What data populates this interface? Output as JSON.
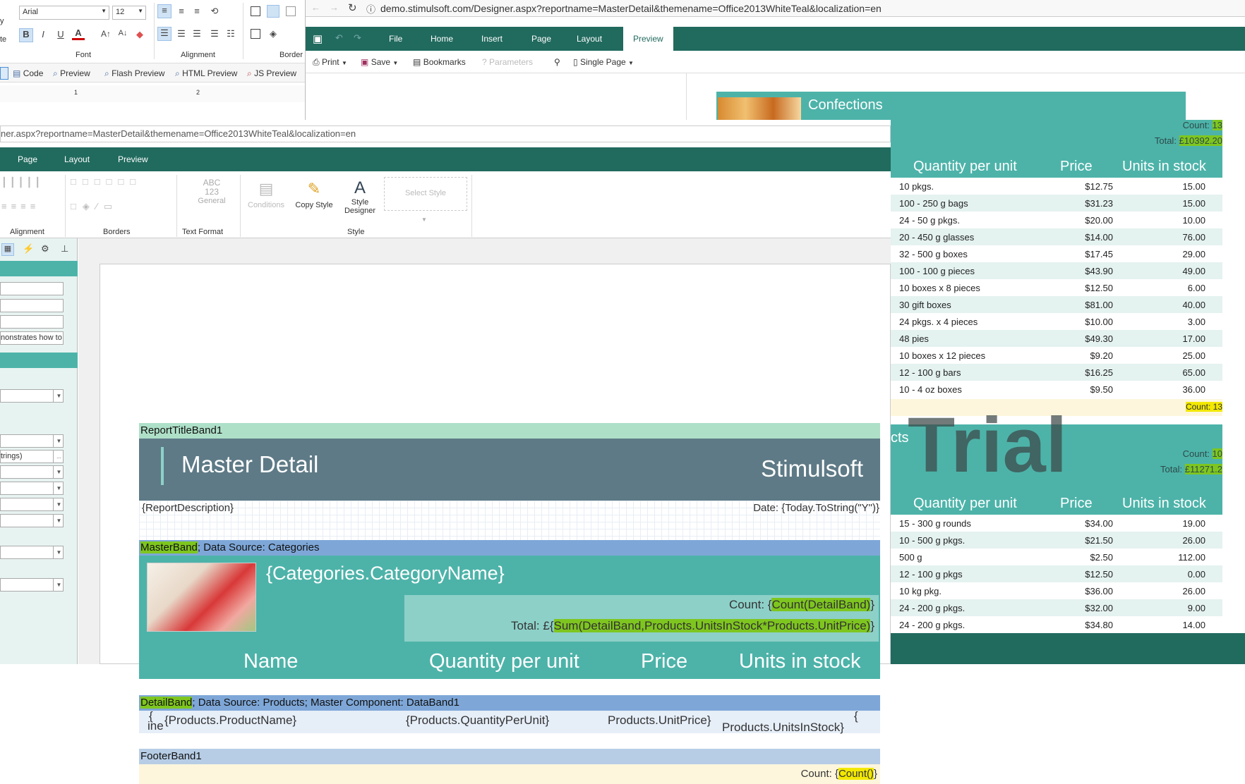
{
  "win_a": {
    "font_name": "Arial",
    "font_size": "12",
    "ribbon_groups": [
      "Font",
      "Alignment",
      "Border"
    ],
    "cut_text": "y",
    "cut_text2": "te",
    "preview_tabs": [
      "Code",
      "Preview",
      "Flash Preview",
      "HTML Preview",
      "JS Preview"
    ],
    "ruler_marks": [
      "1",
      "2"
    ]
  },
  "win_b": {
    "address": "ner.aspx?reportname=MasterDetail&themename=Office2013WhiteTeal&localization=en",
    "tabs": [
      "Page",
      "Layout",
      "Preview"
    ],
    "text_format": {
      "abc": "ABC",
      "num": "123",
      "general": "General"
    },
    "style_buttons": {
      "conditions": "Conditions",
      "copy_style": "Copy Style",
      "style_designer_1": "Style",
      "style_designer_2": "Designer",
      "select_style": "Select Style"
    },
    "group_labels": {
      "alignment": "Alignment",
      "borders": "Borders",
      "text_format": "Text Format",
      "style": "Style"
    },
    "panel": {
      "field_demo": "nonstrates how to",
      "field_strings": "trings)",
      "ellipsis": "..."
    },
    "report": {
      "title_band": "ReportTitleBand1",
      "title": "Master Detail",
      "brand": "Stimulsoft",
      "description": "{ReportDescription}",
      "date": "Date: {Today.ToString(\"Y\")}",
      "master_band_name": "MasterBand",
      "master_band_rest": "; Data Source: Categories",
      "category_name": "{Categories.CategoryName}",
      "count_prefix": "Count: {",
      "count_expr": "Count(DetailBand)",
      "count_suffix": "}",
      "total_prefix": "Total: £{",
      "total_expr": "Sum(DetailBand,Products.UnitsInStock*Products.UnitPrice)",
      "total_suffix": "}",
      "headers": [
        "Name",
        "Quantity per unit",
        "Price",
        "Units in stock"
      ],
      "detail_band_name": "DetailBand",
      "detail_band_rest": "; Data Source: Products; Master Component: DataBand1",
      "line_frag_1": "{",
      "line_frag_2": "ine",
      "cells": [
        "{Products.ProductName}",
        "{Products.QuantityPerUnit}",
        "Products.UnitPrice}",
        "{",
        "Products.UnitsInStock}"
      ],
      "footer_band": "FooterBand1",
      "footer_prefix": "Count: {",
      "footer_expr": "Count()",
      "footer_suffix": "}"
    }
  },
  "win_c": {
    "address": "demo.stimulsoft.com/Designer.aspx?reportname=MasterDetail&themename=Office2013WhiteTeal&localization=en",
    "tabs": [
      "File",
      "Home",
      "Insert",
      "Page",
      "Layout",
      "Preview"
    ],
    "toolbar": {
      "print": "Print",
      "save": "Save",
      "bookmarks": "Bookmarks",
      "parameters": "Parameters",
      "single_page": "Single Page"
    },
    "confections": "Confections"
  },
  "preview": {
    "s1": {
      "count_label": "Count: ",
      "count": "13",
      "total_label": "Total: ",
      "total": "£10392.20",
      "headers": [
        "Quantity per unit",
        "Price",
        "Units in stock"
      ],
      "rows": [
        [
          "10 pkgs.",
          "$12.75",
          "15.00"
        ],
        [
          "100 - 250 g bags",
          "$31.23",
          "15.00"
        ],
        [
          "24 - 50 g pkgs.",
          "$20.00",
          "10.00"
        ],
        [
          "20 - 450 g glasses",
          "$14.00",
          "76.00"
        ],
        [
          "32 - 500 g boxes",
          "$17.45",
          "29.00"
        ],
        [
          "100 - 100 g pieces",
          "$43.90",
          "49.00"
        ],
        [
          "10 boxes x 8 pieces",
          "$12.50",
          "6.00"
        ],
        [
          "30 gift boxes",
          "$81.00",
          "40.00"
        ],
        [
          "24 pkgs. x 4 pieces",
          "$10.00",
          "3.00"
        ],
        [
          "48 pies",
          "$49.30",
          "17.00"
        ],
        [
          "10 boxes x 12 pieces",
          "$9.20",
          "25.00"
        ],
        [
          "12 - 100 g bars",
          "$16.25",
          "65.00"
        ],
        [
          "10 - 4 oz boxes",
          "$9.50",
          "36.00"
        ]
      ],
      "footer": "Count: 13"
    },
    "watermark": "Trial",
    "cts": "cts",
    "s2": {
      "count_label": "Count: ",
      "count": "10",
      "total_label": "Total: ",
      "total": "£11271.2",
      "headers": [
        "Quantity per unit",
        "Price",
        "Units in stock"
      ],
      "rows": [
        [
          "15 - 300 g rounds",
          "$34.00",
          "19.00"
        ],
        [
          "10 - 500 g pkgs.",
          "$21.50",
          "26.00"
        ],
        [
          "500 g",
          "$2.50",
          "112.00"
        ],
        [
          "12 - 100 g pkgs",
          "$12.50",
          "0.00"
        ],
        [
          "10 kg pkg.",
          "$36.00",
          "26.00"
        ],
        [
          "24 - 200 g pkgs.",
          "$32.00",
          "9.00"
        ],
        [
          "24 - 200 g pkgs.",
          "$34.80",
          "14.00"
        ]
      ]
    }
  },
  "colors": {
    "teal_dark": "#216a5e",
    "teal": "#4db3a9",
    "teal_light": "#8dd0c8",
    "title_band": "#5e7a86",
    "band_blue": "#7ea7d8",
    "highlight_green": "#7ec61f",
    "highlight_yellow": "#f2e800"
  }
}
